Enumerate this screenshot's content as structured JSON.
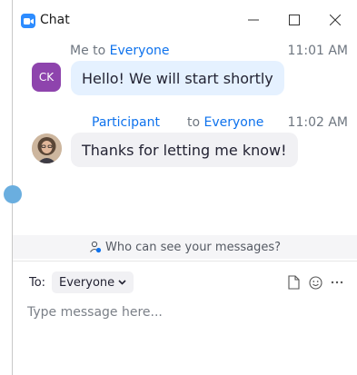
{
  "window": {
    "title": "Chat",
    "controls": {
      "minimize_icon": "minimize-icon",
      "maximize_icon": "maximize-icon",
      "close_icon": "close-icon"
    }
  },
  "messages": [
    {
      "sender_prefix": "Me to ",
      "target": "Everyone",
      "time": "11:01 AM",
      "avatar_initials": "CK",
      "avatar_color": "#8e44ad",
      "text": "Hello! We will start shortly",
      "bubble_color": "#e5f1ff"
    },
    {
      "sender_name": "Participant",
      "to_prefix": "to ",
      "target": "Everyone",
      "time": "11:02 AM",
      "avatar": "profile-photo",
      "text": "Thanks for letting me know!",
      "bubble_color": "#f1f1f4"
    }
  ],
  "visibility_notice": {
    "icon": "person-visibility-icon",
    "text": "Who can see your messages?"
  },
  "composer": {
    "to_label": "To:",
    "recipient": "Everyone",
    "placeholder": "Type message here...",
    "tools": [
      "file-icon",
      "emoji-icon",
      "more-icon"
    ]
  },
  "colors": {
    "accent": "#0e72ed",
    "app_icon": "#2d8cff"
  }
}
